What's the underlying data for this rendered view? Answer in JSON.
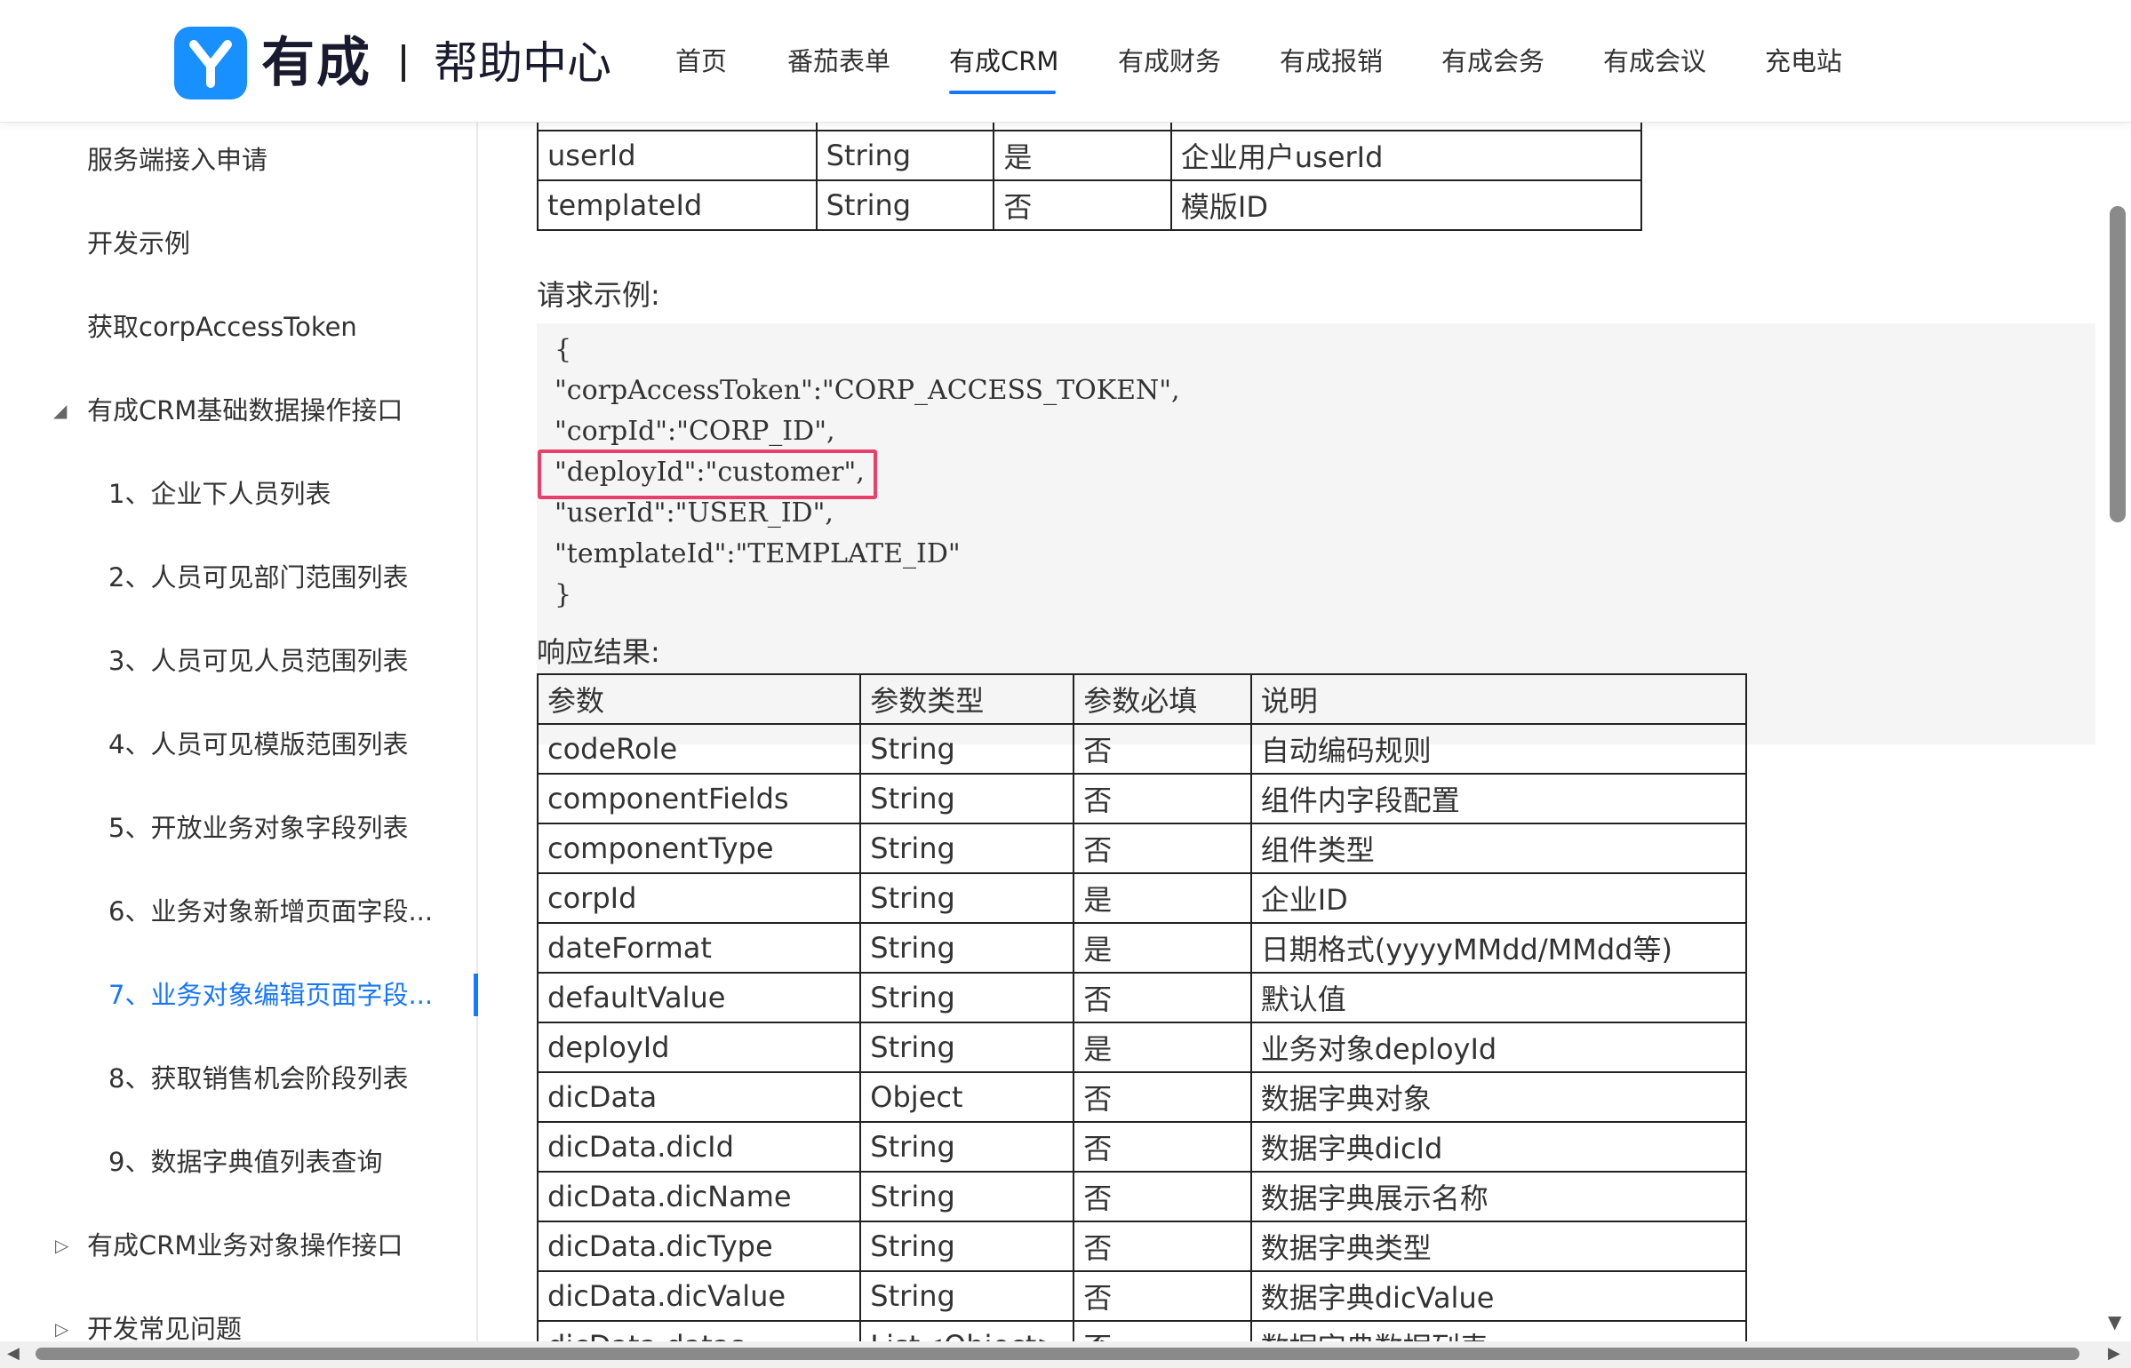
{
  "header": {
    "brand": "有成",
    "subtitle": "帮助中心",
    "nav": [
      "首页",
      "番茄表单",
      "有成CRM",
      "有成财务",
      "有成报销",
      "有成会务",
      "有成会议",
      "充电站"
    ],
    "active_nav": "有成CRM"
  },
  "sidebar": {
    "items": [
      {
        "label": "服务端接入申请"
      },
      {
        "label": "开发示例"
      },
      {
        "label": "获取corpAccessToken"
      },
      {
        "label": "有成CRM基础数据操作接口",
        "expanded": true
      },
      {
        "label": "1、企业下人员列表"
      },
      {
        "label": "2、人员可见部门范围列表"
      },
      {
        "label": "3、人员可见人员范围列表"
      },
      {
        "label": "4、人员可见模版范围列表"
      },
      {
        "label": "5、开放业务对象字段列表"
      },
      {
        "label": "6、业务对象新增页面字段..."
      },
      {
        "label": "7、业务对象编辑页面字段...",
        "active": true
      },
      {
        "label": "8、获取销售机会阶段列表"
      },
      {
        "label": "9、数据字典值列表查询"
      },
      {
        "label": "有成CRM业务对象操作接口",
        "expanded": false
      },
      {
        "label": "开发常见问题",
        "expanded": false
      }
    ]
  },
  "request_params_table": {
    "rows": [
      [
        "userId",
        "String",
        "是",
        "企业用户userId"
      ],
      [
        "templateId",
        "String",
        "否",
        "模版ID"
      ]
    ]
  },
  "request_example": {
    "label": "请求示例:",
    "lines": [
      "{",
      "\"corpAccessToken\":\"CORP_ACCESS_TOKEN\",",
      "\"corpId\":\"CORP_ID\",",
      "\"deployId\":\"customer\",",
      "\"userId\":\"USER_ID\",",
      "\"templateId\":\"TEMPLATE_ID\"",
      "}"
    ],
    "highlighted_line": 3
  },
  "response": {
    "label": "响应结果:",
    "headers": [
      "参数",
      "参数类型",
      "参数必填",
      "说明"
    ],
    "rows": [
      [
        "codeRole",
        "String",
        "否",
        "自动编码规则"
      ],
      [
        "componentFields",
        "String",
        "否",
        "组件内字段配置"
      ],
      [
        "componentType",
        "String",
        "否",
        "组件类型"
      ],
      [
        "corpId",
        "String",
        "是",
        "企业ID"
      ],
      [
        "dateFormat",
        "String",
        "是",
        "日期格式(yyyyMMdd/MMdd等)"
      ],
      [
        "defaultValue",
        "String",
        "否",
        "默认值"
      ],
      [
        "deployId",
        "String",
        "是",
        "业务对象deployId"
      ],
      [
        "dicData",
        "Object",
        "否",
        "数据字典对象"
      ],
      [
        "dicData.dicId",
        "String",
        "否",
        "数据字典dicId"
      ],
      [
        "dicData.dicName",
        "String",
        "否",
        "数据字典展示名称"
      ],
      [
        "dicData.dicType",
        "String",
        "否",
        "数据字典类型"
      ],
      [
        "dicData.dicValue",
        "String",
        "否",
        "数据字典dicValue"
      ],
      [
        "dicData.datas",
        "List<Object>",
        "否",
        "数据字典数据列表"
      ]
    ]
  },
  "colors": {
    "accent": "#1677ff",
    "logo": "#1890ff",
    "highlight_border": "#e8406a",
    "code_bg": "#f5f5f5"
  }
}
